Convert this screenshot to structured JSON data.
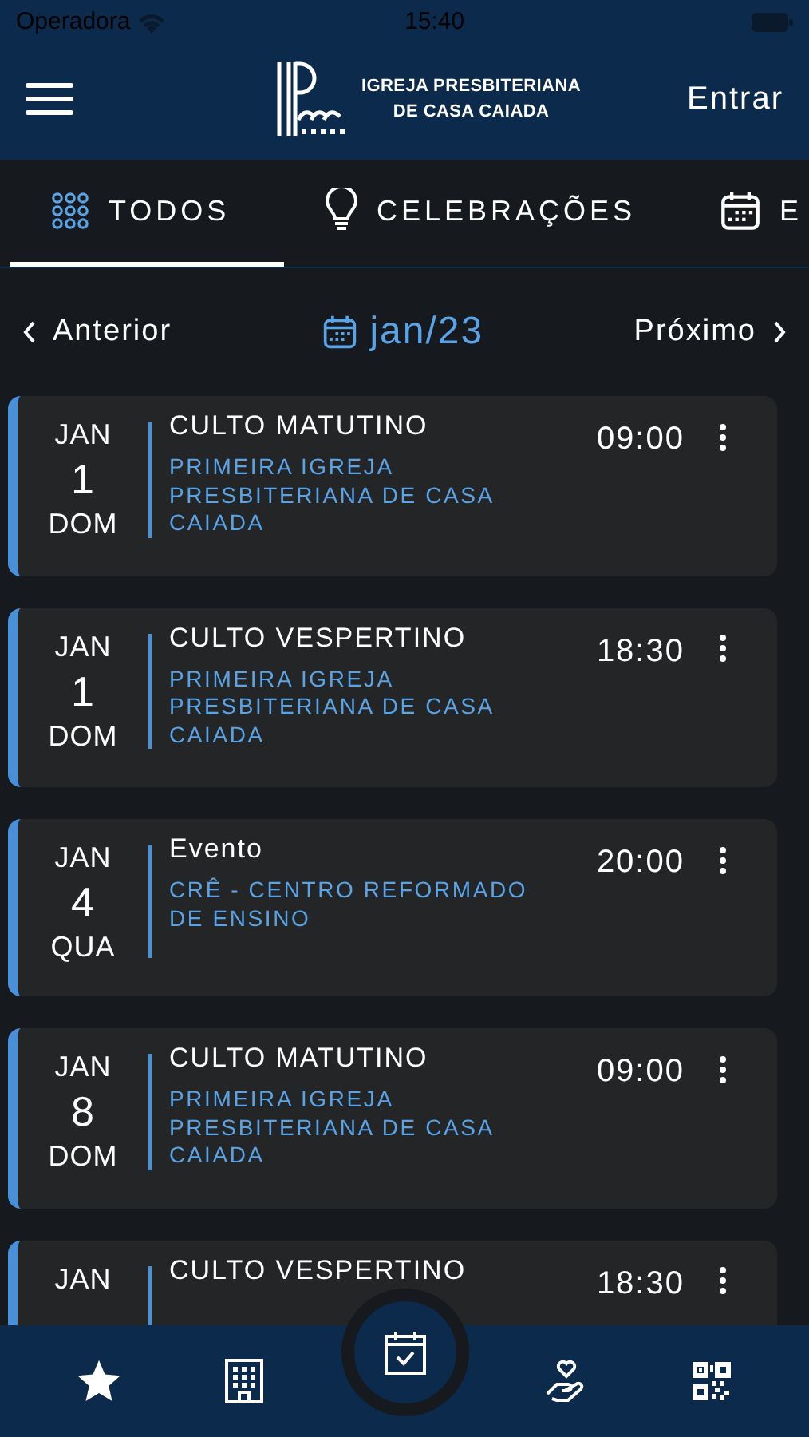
{
  "status_bar": {
    "carrier": "Operadora",
    "time": "15:40"
  },
  "header": {
    "brand_line_1": "IGREJA PRESBITERIANA",
    "brand_line_2": "DE CASA CAIADA",
    "login": "Entrar"
  },
  "tabs": [
    {
      "kind": "grid",
      "label": "TODOS",
      "selected": true
    },
    {
      "kind": "bulb",
      "label": "CELEBRAÇÕES",
      "selected": false
    },
    {
      "kind": "calendar",
      "label": "E",
      "selected": false
    }
  ],
  "month_nav": {
    "previous": "Anterior",
    "current": "jan/23",
    "next": "Próximo"
  },
  "events": [
    {
      "month": "JAN",
      "day": "1",
      "weekday": "DOM",
      "title": "CULTO MATUTINO",
      "location": "PRIMEIRA IGREJA PRESBITERIANA DE CASA CAIADA",
      "time": "09:00"
    },
    {
      "month": "JAN",
      "day": "1",
      "weekday": "DOM",
      "title": "CULTO VESPERTINO",
      "location": "PRIMEIRA IGREJA PRESBITERIANA DE CASA CAIADA",
      "time": "18:30"
    },
    {
      "month": "JAN",
      "day": "4",
      "weekday": "QUA",
      "title": "Evento",
      "location": "CRÊ - CENTRO REFORMADO DE ENSINO",
      "time": "20:00"
    },
    {
      "month": "JAN",
      "day": "8",
      "weekday": "DOM",
      "title": "CULTO MATUTINO",
      "location": "PRIMEIRA IGREJA PRESBITERIANA DE CASA CAIADA",
      "time": "09:00"
    },
    {
      "month": "JAN",
      "title": "CULTO VESPERTINO",
      "time": "18:30"
    }
  ],
  "bottom_nav": [
    {
      "kind": "star",
      "selected": false
    },
    {
      "kind": "building",
      "selected": false
    },
    {
      "kind": "calendar-check",
      "selected": true
    },
    {
      "kind": "charity",
      "selected": false
    },
    {
      "kind": "qr",
      "selected": false
    }
  ]
}
